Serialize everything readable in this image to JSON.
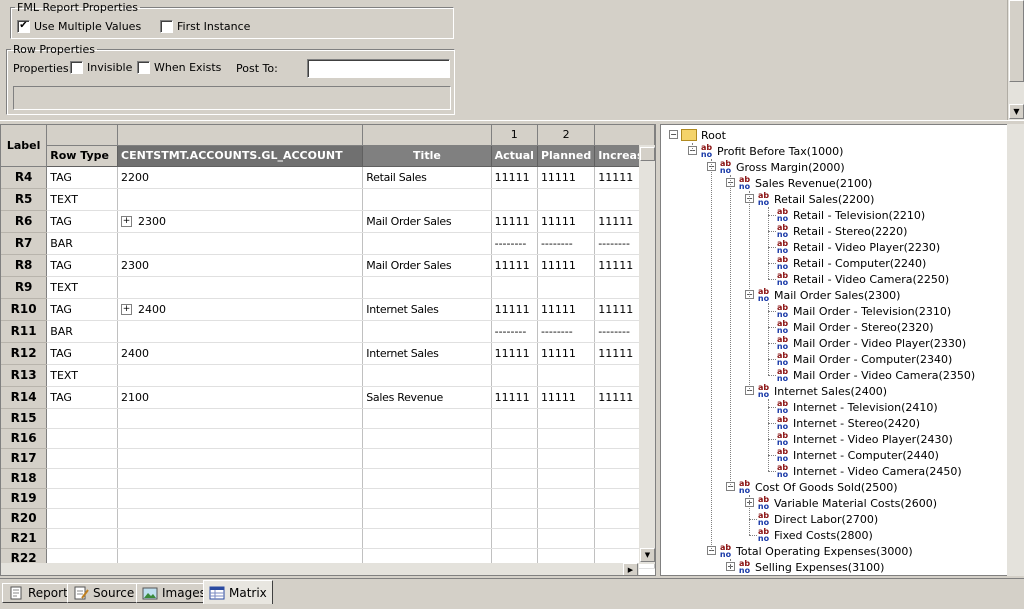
{
  "fml": {
    "legend": "FML Report Properties",
    "use_multiple_values": {
      "label": "Use Multiple Values",
      "checked": true
    },
    "first_instance": {
      "label": "First Instance",
      "checked": false
    }
  },
  "row_props": {
    "legend": "Row Properties",
    "properties_label": "Properties:",
    "invisible": {
      "label": "Invisible",
      "checked": false
    },
    "when_exists": {
      "label": "When Exists",
      "checked": false
    },
    "post_to_label": "Post To:",
    "post_to_value": ""
  },
  "matrix": {
    "corner": "Label",
    "col_numbers": [
      "",
      "",
      "",
      "1",
      "2",
      ""
    ],
    "headers": {
      "row_type": "Row Type",
      "account": "CENTSTMT.ACCOUNTS.GL_ACCOUNT",
      "title": "Title",
      "c1": "Actual",
      "c2": "Planned",
      "c3": "Increase"
    },
    "rows": [
      {
        "label": "R4",
        "type": "TAG",
        "account": "2200",
        "expand": false,
        "title": "Retail Sales",
        "c1": "11111",
        "c2": "11111",
        "c3": "11111"
      },
      {
        "label": "R5",
        "type": "TEXT",
        "account": "",
        "expand": false,
        "title": "",
        "c1": "",
        "c2": "",
        "c3": ""
      },
      {
        "label": "R6",
        "type": "TAG",
        "account": "2300",
        "expand": true,
        "title": "Mail Order Sales",
        "c1": "11111",
        "c2": "11111",
        "c3": "11111"
      },
      {
        "label": "R7",
        "type": "BAR",
        "account": "",
        "expand": false,
        "title": "",
        "c1": "--------",
        "c2": "--------",
        "c3": "--------"
      },
      {
        "label": "R8",
        "type": "TAG",
        "account": "2300",
        "expand": false,
        "title": "Mail Order Sales",
        "c1": "11111",
        "c2": "11111",
        "c3": "11111"
      },
      {
        "label": "R9",
        "type": "TEXT",
        "account": "",
        "expand": false,
        "title": "",
        "c1": "",
        "c2": "",
        "c3": ""
      },
      {
        "label": "R10",
        "type": "TAG",
        "account": "2400",
        "expand": true,
        "title": "Internet Sales",
        "c1": "11111",
        "c2": "11111",
        "c3": "11111"
      },
      {
        "label": "R11",
        "type": "BAR",
        "account": "",
        "expand": false,
        "title": "",
        "c1": "--------",
        "c2": "--------",
        "c3": "--------"
      },
      {
        "label": "R12",
        "type": "TAG",
        "account": "2400",
        "expand": false,
        "title": "Internet Sales",
        "c1": "11111",
        "c2": "11111",
        "c3": "11111"
      },
      {
        "label": "R13",
        "type": "TEXT",
        "account": "",
        "expand": false,
        "title": "",
        "c1": "",
        "c2": "",
        "c3": ""
      },
      {
        "label": "R14",
        "type": "TAG",
        "account": "2100",
        "expand": false,
        "title": "Sales Revenue",
        "c1": "11111",
        "c2": "11111",
        "c3": "11111"
      },
      {
        "label": "R15",
        "type": "",
        "account": "",
        "expand": false,
        "title": "",
        "c1": "",
        "c2": "",
        "c3": ""
      },
      {
        "label": "R16",
        "type": "",
        "account": "",
        "expand": false,
        "title": "",
        "c1": "",
        "c2": "",
        "c3": ""
      },
      {
        "label": "R17",
        "type": "",
        "account": "",
        "expand": false,
        "title": "",
        "c1": "",
        "c2": "",
        "c3": ""
      },
      {
        "label": "R18",
        "type": "",
        "account": "",
        "expand": false,
        "title": "",
        "c1": "",
        "c2": "",
        "c3": ""
      },
      {
        "label": "R19",
        "type": "",
        "account": "",
        "expand": false,
        "title": "",
        "c1": "",
        "c2": "",
        "c3": ""
      },
      {
        "label": "R20",
        "type": "",
        "account": "",
        "expand": false,
        "title": "",
        "c1": "",
        "c2": "",
        "c3": ""
      },
      {
        "label": "R21",
        "type": "",
        "account": "",
        "expand": false,
        "title": "",
        "c1": "",
        "c2": "",
        "c3": ""
      },
      {
        "label": "R22",
        "type": "",
        "account": "",
        "expand": false,
        "title": "",
        "c1": "",
        "c2": "",
        "c3": ""
      }
    ]
  },
  "tree": [
    {
      "label": "Root",
      "depth": 0,
      "icon": "folder-icon",
      "expander": "-"
    },
    {
      "label": "Profit Before Tax(1000)",
      "depth": 1,
      "icon": "ab-icon",
      "expander": "-"
    },
    {
      "label": "Gross Margin(2000)",
      "depth": 2,
      "icon": "ab-icon",
      "expander": "-"
    },
    {
      "label": "Sales Revenue(2100)",
      "depth": 3,
      "icon": "ab-icon",
      "expander": "-"
    },
    {
      "label": "Retail Sales(2200)",
      "depth": 4,
      "icon": "ab-icon",
      "expander": "-"
    },
    {
      "label": "Retail - Television(2210)",
      "depth": 5,
      "icon": "ab-icon",
      "expander": ""
    },
    {
      "label": "Retail - Stereo(2220)",
      "depth": 5,
      "icon": "ab-icon",
      "expander": ""
    },
    {
      "label": "Retail - Video Player(2230)",
      "depth": 5,
      "icon": "ab-icon",
      "expander": ""
    },
    {
      "label": "Retail - Computer(2240)",
      "depth": 5,
      "icon": "ab-icon",
      "expander": ""
    },
    {
      "label": "Retail - Video Camera(2250)",
      "depth": 5,
      "icon": "ab-icon",
      "expander": ""
    },
    {
      "label": "Mail Order Sales(2300)",
      "depth": 4,
      "icon": "ab-icon",
      "expander": "-"
    },
    {
      "label": "Mail Order - Television(2310)",
      "depth": 5,
      "icon": "ab-icon",
      "expander": ""
    },
    {
      "label": "Mail Order - Stereo(2320)",
      "depth": 5,
      "icon": "ab-icon",
      "expander": ""
    },
    {
      "label": "Mail Order - Video Player(2330)",
      "depth": 5,
      "icon": "ab-icon",
      "expander": ""
    },
    {
      "label": "Mail Order - Computer(2340)",
      "depth": 5,
      "icon": "ab-icon",
      "expander": ""
    },
    {
      "label": "Mail Order - Video Camera(2350)",
      "depth": 5,
      "icon": "ab-icon",
      "expander": ""
    },
    {
      "label": "Internet Sales(2400)",
      "depth": 4,
      "icon": "ab-icon",
      "expander": "-"
    },
    {
      "label": "Internet - Television(2410)",
      "depth": 5,
      "icon": "ab-icon",
      "expander": ""
    },
    {
      "label": "Internet - Stereo(2420)",
      "depth": 5,
      "icon": "ab-icon",
      "expander": ""
    },
    {
      "label": "Internet - Video Player(2430)",
      "depth": 5,
      "icon": "ab-icon",
      "expander": ""
    },
    {
      "label": "Internet - Computer(2440)",
      "depth": 5,
      "icon": "ab-icon",
      "expander": ""
    },
    {
      "label": "Internet - Video Camera(2450)",
      "depth": 5,
      "icon": "ab-icon",
      "expander": ""
    },
    {
      "label": "Cost Of Goods Sold(2500)",
      "depth": 3,
      "icon": "ab-icon",
      "expander": "-"
    },
    {
      "label": "Variable Material Costs(2600)",
      "depth": 4,
      "icon": "ab-icon",
      "expander": "+"
    },
    {
      "label": "Direct Labor(2700)",
      "depth": 4,
      "icon": "ab-icon",
      "expander": ""
    },
    {
      "label": "Fixed Costs(2800)",
      "depth": 4,
      "icon": "ab-icon",
      "expander": ""
    },
    {
      "label": "Total Operating Expenses(3000)",
      "depth": 2,
      "icon": "ab-icon",
      "expander": "-"
    },
    {
      "label": "Selling Expenses(3100)",
      "depth": 3,
      "icon": "ab-icon",
      "expander": "+"
    }
  ],
  "tabs": [
    {
      "label": "Report",
      "icon": "report-icon",
      "active": false
    },
    {
      "label": "Source",
      "icon": "source-icon",
      "active": false
    },
    {
      "label": "Images",
      "icon": "images-icon",
      "active": false
    },
    {
      "label": "Matrix",
      "icon": "matrix-icon",
      "active": true
    }
  ]
}
